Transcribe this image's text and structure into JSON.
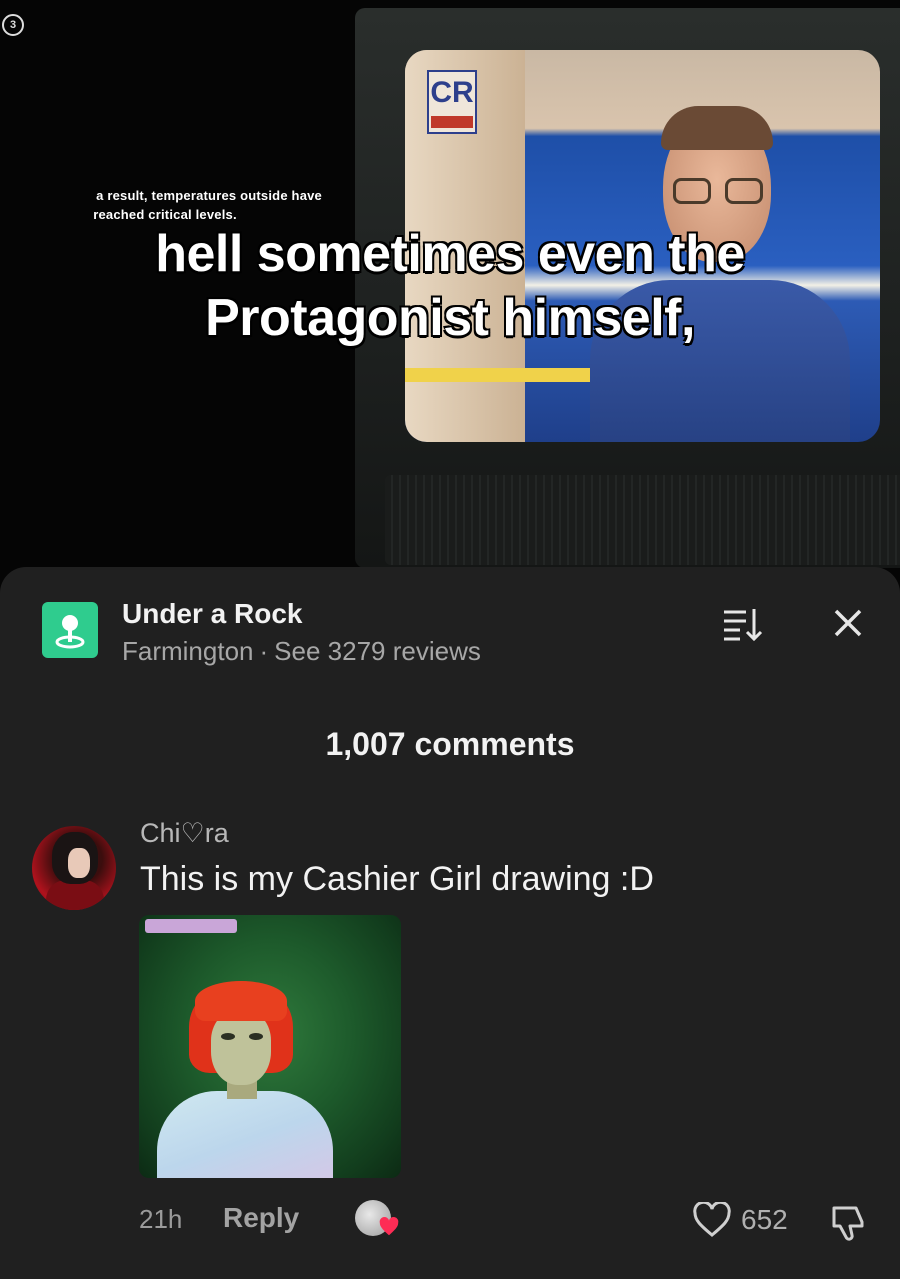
{
  "video": {
    "corner_logo": "3",
    "tv_logo": "CR",
    "small_caption_line1": "a result, temperatures outside have",
    "small_caption_line2": "reached critical levels.",
    "caption_line1": "hell sometimes even the",
    "caption_line2": "Protagonist himself,"
  },
  "header": {
    "place_icon": "map-pin-icon",
    "place_title": "Under a Rock",
    "place_location": "Farmington",
    "separator": "·",
    "reviews_link": "See 3279 reviews",
    "sort_icon": "sort-icon",
    "close_icon": "close-icon",
    "accent_color": "#2fcc8e"
  },
  "comments_count": "1,007 comments",
  "comment": {
    "username": "Chi♡ra",
    "text": "This is my Cashier Girl drawing :D",
    "time": "21h",
    "reply_label": "Reply",
    "like_count": "652",
    "like_icon": "heart-icon",
    "dislike_icon": "dislike-icon"
  }
}
